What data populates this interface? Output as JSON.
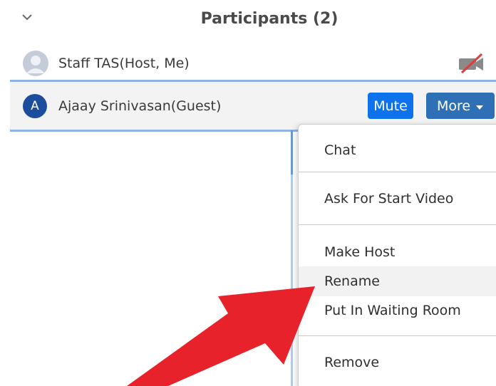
{
  "header": {
    "title": "Participants (2)",
    "collapse_icon": "chevron-down-icon"
  },
  "participants": [
    {
      "name": "Staff TAS(Host, Me)",
      "avatar": "generic-user-icon",
      "status_icon": "video-off-icon"
    },
    {
      "name": "Ajaay Srinivasan(Guest)",
      "avatar_letter": "A",
      "mute_label": "Mute",
      "more_label": "More"
    }
  ],
  "menu": {
    "items": [
      "Chat",
      "Ask For Start Video",
      "Make Host",
      "Rename",
      "Put In Waiting Room",
      "Remove"
    ],
    "highlighted": "Rename"
  },
  "colors": {
    "mute_button": "#0e72ed",
    "more_button": "#2f6fb5",
    "avatar": "#1c4d9c",
    "arrow": "#e8222b",
    "selection_line": "#8fb4e3"
  }
}
